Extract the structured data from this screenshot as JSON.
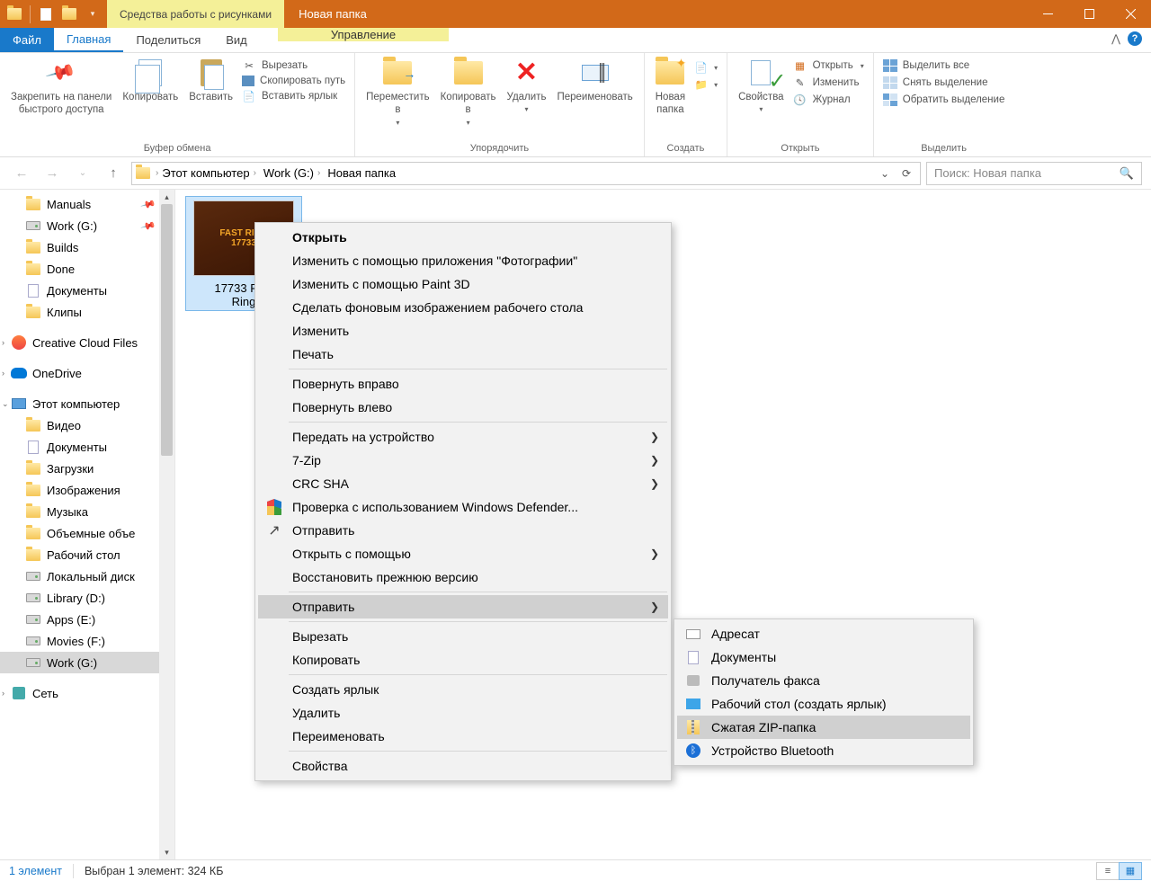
{
  "titlebar": {
    "tool_tab": "Средства работы с рисунками",
    "title": "Новая папка"
  },
  "ribbon_tabs": {
    "file": "Файл",
    "home": "Главная",
    "share": "Поделиться",
    "view": "Вид",
    "manage": "Управление"
  },
  "ribbon": {
    "clipboard": {
      "pin": "Закрепить на панели\nбыстрого доступа",
      "copy": "Копировать",
      "paste": "Вставить",
      "cut": "Вырезать",
      "copy_path": "Скопировать путь",
      "paste_shortcut": "Вставить ярлык",
      "label": "Буфер обмена"
    },
    "organize": {
      "move_to": "Переместить\nв",
      "copy_to": "Копировать\nв",
      "delete": "Удалить",
      "rename": "Переименовать",
      "label": "Упорядочить"
    },
    "new": {
      "new_folder": "Новая\nпапка",
      "label": "Создать"
    },
    "open": {
      "properties": "Свойства",
      "open": "Открыть",
      "edit": "Изменить",
      "history": "Журнал",
      "label": "Открыть"
    },
    "select": {
      "select_all": "Выделить все",
      "select_none": "Снять выделение",
      "invert": "Обратить выделение",
      "label": "Выделить"
    }
  },
  "breadcrumb": {
    "pc": "Этот компьютер",
    "drive": "Work (G:)",
    "folder": "Новая папка"
  },
  "search_placeholder": "Поиск: Новая папка",
  "sidebar": {
    "items": [
      {
        "label": "Manuals",
        "type": "folder",
        "pinned": true,
        "level": 1
      },
      {
        "label": "Work (G:)",
        "type": "drive",
        "pinned": true,
        "level": 1
      },
      {
        "label": "Builds",
        "type": "folder",
        "level": 1
      },
      {
        "label": "Done",
        "type": "folder",
        "level": 1
      },
      {
        "label": "Документы",
        "type": "doc",
        "level": 1
      },
      {
        "label": "Клипы",
        "type": "folder",
        "level": 1
      }
    ],
    "cc": "Creative Cloud Files",
    "onedrive": "OneDrive",
    "this_pc": "Этот компьютер",
    "pc_items": [
      {
        "label": "Видео",
        "type": "folder"
      },
      {
        "label": "Документы",
        "type": "doc"
      },
      {
        "label": "Загрузки",
        "type": "folder"
      },
      {
        "label": "Изображения",
        "type": "folder"
      },
      {
        "label": "Музыка",
        "type": "folder"
      },
      {
        "label": "Объемные объе",
        "type": "folder"
      },
      {
        "label": "Рабочий стол",
        "type": "folder"
      },
      {
        "label": "Локальный диск",
        "type": "drive"
      },
      {
        "label": "Library (D:)",
        "type": "drive"
      },
      {
        "label": "Apps (E:)",
        "type": "drive"
      },
      {
        "label": "Movies (F:)",
        "type": "drive"
      },
      {
        "label": "Work (G:)",
        "type": "drive",
        "selected": true
      }
    ],
    "network": "Сеть"
  },
  "file": {
    "name": "17733 Fast\nRing",
    "thumb_text": "FAST RING\n17733"
  },
  "context_menu": {
    "open": "Открыть",
    "edit_photos": "Изменить с помощью приложения \"Фотографии\"",
    "edit_paint3d": "Изменить с помощью Paint 3D",
    "set_wallpaper": "Сделать фоновым изображением рабочего стола",
    "edit": "Изменить",
    "print": "Печать",
    "rotate_r": "Повернуть вправо",
    "rotate_l": "Повернуть влево",
    "cast": "Передать на устройство",
    "seven_zip": "7-Zip",
    "crc": "CRC SHA",
    "defender": "Проверка с использованием Windows Defender...",
    "share": "Отправить",
    "open_with": "Открыть с помощью",
    "restore": "Восстановить прежнюю версию",
    "send_to": "Отправить",
    "cut": "Вырезать",
    "copy": "Копировать",
    "create_shortcut": "Создать ярлык",
    "delete": "Удалить",
    "rename": "Переименовать",
    "properties": "Свойства"
  },
  "send_to_menu": {
    "recipient": "Адресат",
    "documents": "Документы",
    "fax": "Получатель факса",
    "desktop": "Рабочий стол (создать ярлык)",
    "zip": "Сжатая ZIP-папка",
    "bluetooth": "Устройство Bluetooth"
  },
  "status": {
    "count": "1 элемент",
    "selected": "Выбран 1 элемент: 324 КБ"
  }
}
